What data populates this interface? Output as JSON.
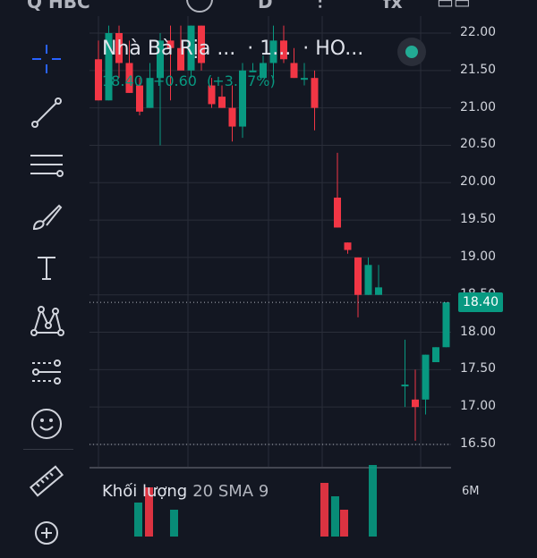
{
  "chart": {
    "symbol_name": "Nhà Bà Rịa ...",
    "interval": "· 1...",
    "exchange": "· HO...",
    "last_price": "18.40",
    "change": "+0.60",
    "change_pct": "(+3.37%)",
    "up_color": "#089981",
    "down_color": "#f23645"
  },
  "price_axis": {
    "labels": [
      "22.00",
      "21.50",
      "21.00",
      "20.50",
      "20.00",
      "19.50",
      "19.00",
      "18.50",
      "18.00",
      "17.50",
      "17.00",
      "16.50"
    ],
    "current": "18.40"
  },
  "volume": {
    "label": "Khối lượng",
    "indicator": "20 SMA 9",
    "axis_label": "6M"
  },
  "toolbar_icons": [
    "crosshair-icon",
    "trend-line-icon",
    "horizontal-lines-icon",
    "brush-icon",
    "text-icon",
    "pattern-icon",
    "forecast-icon",
    "emoji-icon",
    "ruler-icon",
    "zoom-in-icon"
  ],
  "chart_data": {
    "type": "candlestick",
    "ylim": [
      16.5,
      22.0
    ],
    "candles": [
      {
        "o": 21.65,
        "h": 21.9,
        "l": 21.1,
        "c": 21.1
      },
      {
        "o": 21.1,
        "h": 22.1,
        "l": 21.1,
        "c": 22.0
      },
      {
        "o": 22.0,
        "h": 22.1,
        "l": 21.4,
        "c": 21.6
      },
      {
        "o": 21.6,
        "h": 21.9,
        "l": 21.2,
        "c": 21.2
      },
      {
        "o": 21.3,
        "h": 21.4,
        "l": 20.9,
        "c": 20.95
      },
      {
        "o": 21.0,
        "h": 21.6,
        "l": 21.0,
        "c": 21.4
      },
      {
        "o": 21.4,
        "h": 22.0,
        "l": 20.5,
        "c": 21.9
      },
      {
        "o": 21.9,
        "h": 22.1,
        "l": 21.1,
        "c": 21.8
      },
      {
        "o": 21.8,
        "h": 22.1,
        "l": 21.6,
        "c": 21.5
      },
      {
        "o": 21.5,
        "h": 22.1,
        "l": 21.4,
        "c": 22.1
      },
      {
        "o": 22.1,
        "h": 22.1,
        "l": 21.5,
        "c": 21.6
      },
      {
        "o": 21.3,
        "h": 21.4,
        "l": 21.0,
        "c": 21.05
      },
      {
        "o": 21.15,
        "h": 21.3,
        "l": 21.0,
        "c": 21.0
      },
      {
        "o": 21.0,
        "h": 21.3,
        "l": 20.55,
        "c": 20.75
      },
      {
        "o": 20.75,
        "h": 21.6,
        "l": 20.6,
        "c": 21.5
      },
      {
        "o": 21.5,
        "h": 21.6,
        "l": 21.5,
        "c": 21.5
      },
      {
        "o": 21.4,
        "h": 21.7,
        "l": 21.4,
        "c": 21.6
      },
      {
        "o": 21.6,
        "h": 22.1,
        "l": 21.4,
        "c": 21.9
      },
      {
        "o": 21.9,
        "h": 22.1,
        "l": 21.6,
        "c": 21.65
      },
      {
        "o": 21.6,
        "h": 21.8,
        "l": 21.4,
        "c": 21.4
      },
      {
        "o": 21.4,
        "h": 21.6,
        "l": 21.3,
        "c": 21.4
      },
      {
        "o": 21.4,
        "h": 21.5,
        "l": 20.7,
        "c": 21.0
      },
      {
        "o": 19.8,
        "h": 20.4,
        "l": 19.4,
        "c": 19.4
      },
      {
        "o": 19.2,
        "h": 19.2,
        "l": 19.05,
        "c": 19.1
      },
      {
        "o": 19.0,
        "h": 19.0,
        "l": 18.2,
        "c": 18.5
      },
      {
        "o": 18.5,
        "h": 19.0,
        "l": 18.5,
        "c": 18.9
      },
      {
        "o": 18.5,
        "h": 18.9,
        "l": 18.5,
        "c": 18.6
      },
      {
        "o": 17.3,
        "h": 17.9,
        "l": 17.0,
        "c": 17.3
      },
      {
        "o": 17.1,
        "h": 17.5,
        "l": 16.55,
        "c": 17.0
      },
      {
        "o": 17.1,
        "h": 17.7,
        "l": 16.9,
        "c": 17.7
      },
      {
        "o": 17.6,
        "h": 17.8,
        "l": 17.6,
        "c": 17.8
      },
      {
        "o": 17.8,
        "h": 18.4,
        "l": 17.8,
        "c": 18.4
      }
    ],
    "volume_up_color": "#089981",
    "volume_down_color": "#f23645"
  }
}
